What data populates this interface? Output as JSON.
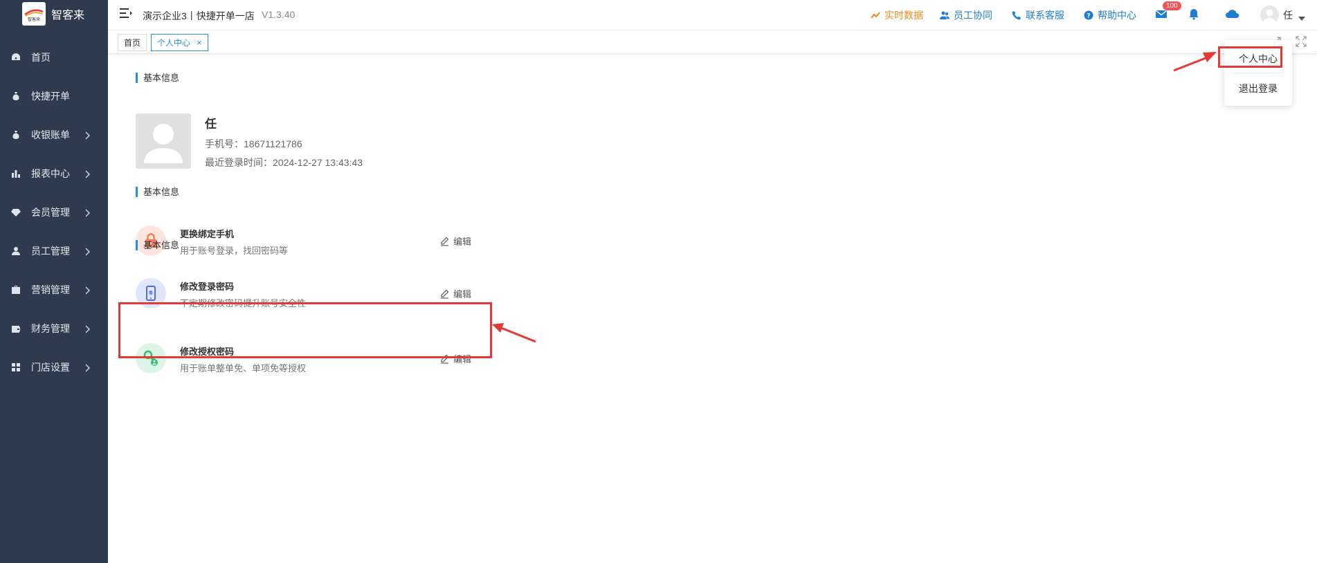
{
  "sidebar": {
    "logo_text": "智客来",
    "logo_small": "智客来",
    "items": [
      {
        "label": "首页",
        "icon": "dashboard-icon",
        "has_children": false
      },
      {
        "label": "快捷开单",
        "icon": "money-bag-icon",
        "has_children": false
      },
      {
        "label": "收银账单",
        "icon": "money-bag-icon",
        "has_children": true
      },
      {
        "label": "报表中心",
        "icon": "bar-chart-icon",
        "has_children": true
      },
      {
        "label": "会员管理",
        "icon": "diamond-icon",
        "has_children": true
      },
      {
        "label": "员工管理",
        "icon": "user-icon",
        "has_children": true
      },
      {
        "label": "营销管理",
        "icon": "briefcase-icon",
        "has_children": true
      },
      {
        "label": "财务管理",
        "icon": "wallet-icon",
        "has_children": true
      },
      {
        "label": "门店设置",
        "icon": "grid-icon",
        "has_children": true
      }
    ]
  },
  "header": {
    "title": "演示企业3丨快捷开单一店",
    "version": "V1.3.40",
    "links": {
      "realtime": "实时数据",
      "staff": "员工协同",
      "support": "联系客服",
      "help": "帮助中心"
    },
    "message_badge": "100",
    "user_name": "任"
  },
  "tabs": [
    {
      "label": "首页",
      "active": false
    },
    {
      "label": "个人中心",
      "active": true,
      "close": "×"
    }
  ],
  "profile": {
    "section_title": "基本信息",
    "name": "任",
    "phone_label": "手机号：",
    "phone": "18671121786",
    "last_login_label": "最近登录时间：",
    "last_login": "2024-12-27 13:43:43"
  },
  "security": {
    "section_title_1": "基本信息",
    "section_title_2": "基本信息",
    "edit_label": "编辑",
    "rows": [
      {
        "title": "更换绑定手机",
        "desc": "用于账号登录，找回密码等",
        "icon": "lock-icon",
        "color": "#f47b5b"
      },
      {
        "title": "修改登录密码",
        "desc": "不定期修改密码提升账号安全性",
        "icon": "phone-link-icon",
        "color": "#4a6cf0"
      },
      {
        "title": "修改授权密码",
        "desc": "用于账单整单免、单项免等授权",
        "icon": "key-user-icon",
        "color": "#2fbf6e"
      }
    ]
  },
  "dropdown": {
    "items": [
      "个人中心",
      "退出登录"
    ]
  },
  "colors": {
    "sidebar_bg": "#2e3a4e",
    "accent": "#2b90d9",
    "highlight": "#e53935",
    "orange": "#ee8a1e"
  }
}
